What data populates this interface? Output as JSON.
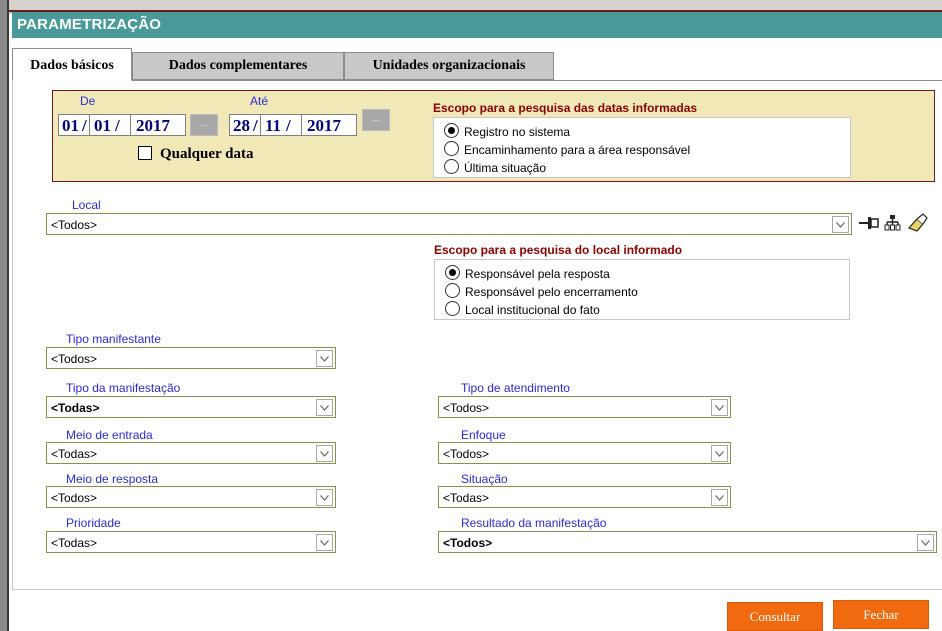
{
  "window": {
    "title": "PARAMETRIZAÇÃO"
  },
  "tabs": [
    {
      "label": "Dados básicos",
      "active": true
    },
    {
      "label": "Dados complementares",
      "active": false
    },
    {
      "label": "Unidades organizacionais",
      "active": false
    }
  ],
  "dates": {
    "from_label": "De",
    "from": {
      "day": "01",
      "month": "01",
      "year": "2017"
    },
    "to_label": "Até",
    "to": {
      "day": "28",
      "month": "11",
      "year": "2017"
    },
    "sep": "/",
    "picker_label": "...",
    "any_date_label": "Qualquer data",
    "any_date_checked": false,
    "scope_title": "Escopo para a pesquisa das datas informadas",
    "scope_options": [
      "Registro no sistema",
      "Encaminhamento para a área responsável",
      "Última situação"
    ],
    "scope_selected": 0
  },
  "local": {
    "label": "Local",
    "value": "<Todos>",
    "scope_title": "Escopo para a pesquisa do local informado",
    "scope_options": [
      "Responsável pela resposta",
      "Responsável pelo encerramento",
      "Local institucional do fato"
    ],
    "scope_selected": 0,
    "tool_icons": [
      "pin-icon",
      "hierarchy-icon",
      "eraser-icon"
    ]
  },
  "filters": {
    "tipo_manifestante": {
      "label": "Tipo manifestante",
      "value": "<Todos>"
    },
    "tipo_manifestacao": {
      "label": "Tipo da manifestação",
      "value": "<Todas>"
    },
    "tipo_atendimento": {
      "label": "Tipo de atendimento",
      "value": "<Todos>"
    },
    "meio_entrada": {
      "label": "Meio de entrada",
      "value": "<Todas>"
    },
    "enfoque": {
      "label": "Enfoque",
      "value": "<Todos>"
    },
    "meio_resposta": {
      "label": "Meio de resposta",
      "value": "<Todos>"
    },
    "situacao": {
      "label": "Situação",
      "value": "<Todas>"
    },
    "prioridade": {
      "label": "Prioridade",
      "value": "<Todas>"
    },
    "resultado": {
      "label": "Resultado da manifestação",
      "value": "<Todos>"
    }
  },
  "actions": {
    "consultar": "Consultar",
    "fechar": "Fechar"
  },
  "colors": {
    "title_bar": "#4a9a9a",
    "accent_button": "#f26a10",
    "date_panel": "#f1e8b8",
    "label_blue": "#2b2bd6",
    "scope_red": "#8b0000"
  }
}
